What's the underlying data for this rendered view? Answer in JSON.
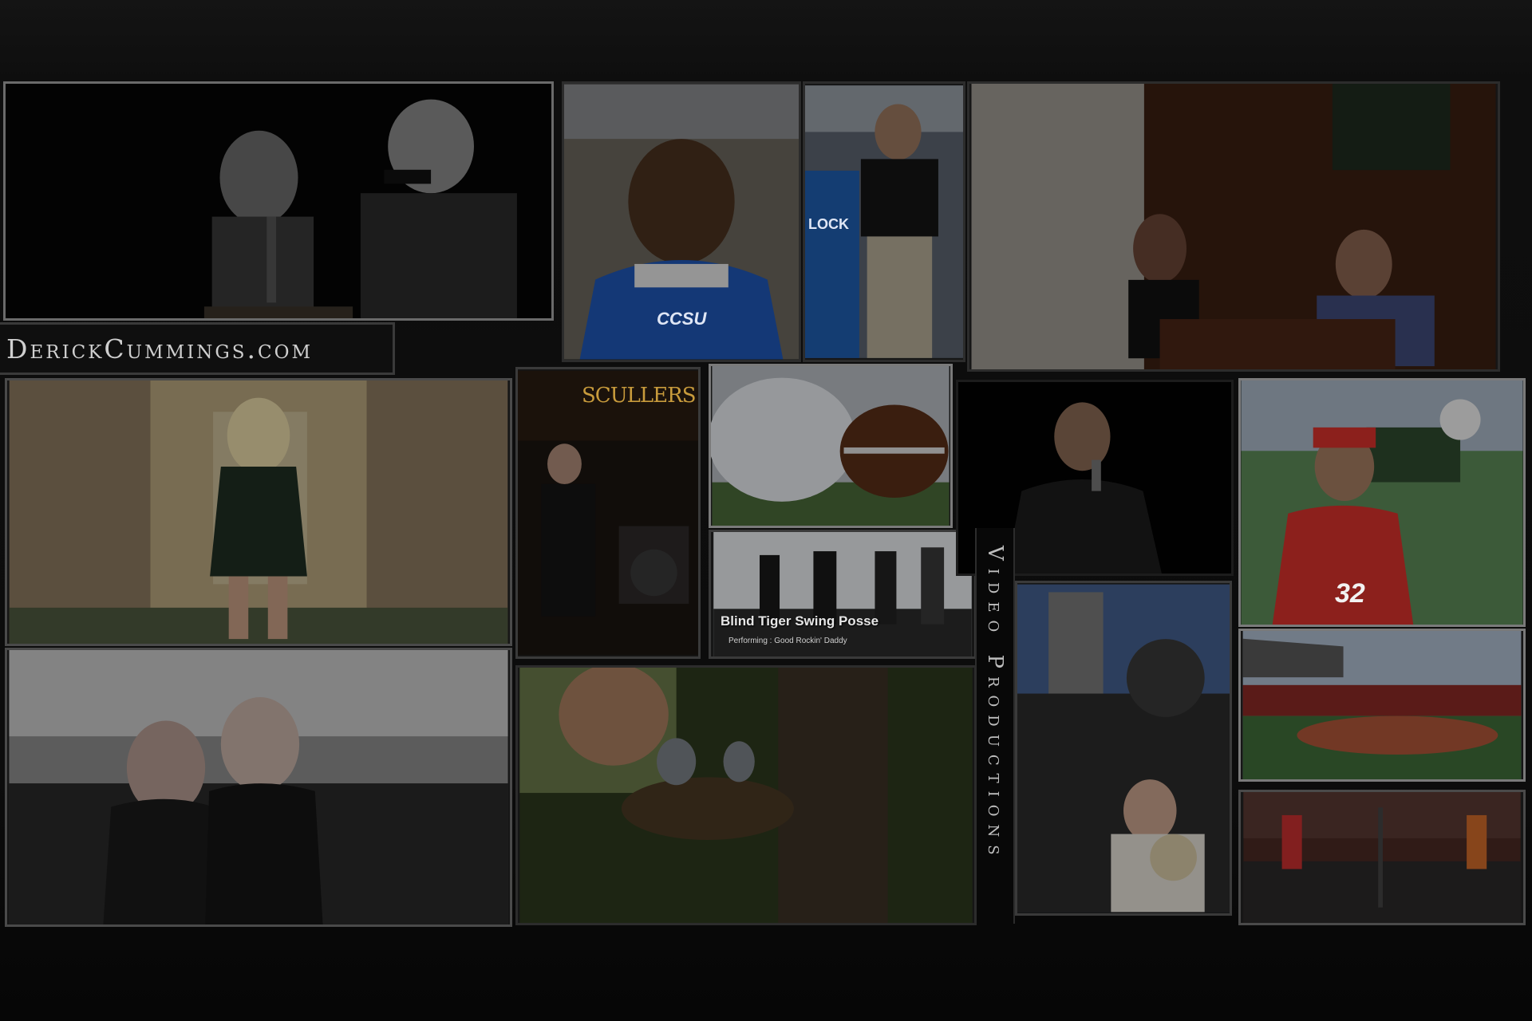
{
  "site": {
    "logo_text": "DerickCummings.com",
    "tagline": "Video Productions"
  },
  "tiles": {
    "speech": {
      "alt": "Two boys at a podium"
    },
    "football_player": {
      "alt": "Football player in blue jersey",
      "jersey_text": "CCSU"
    },
    "coach": {
      "alt": "Man standing by stadium",
      "jersey_text": "LOCK"
    },
    "restaurant": {
      "alt": "Couple at restaurant table"
    },
    "hallway_woman": {
      "alt": "Woman in hotel hallway"
    },
    "scullers": {
      "alt": "Saxophone player on stage",
      "sign_text": "SCULLERS"
    },
    "helmet_ball": {
      "alt": "Football helmet and ball"
    },
    "band": {
      "alt": "Band performing",
      "title": "Blind Tiger Swing Posse",
      "subtitle": "Performing : Good Rockin' Daddy"
    },
    "singer": {
      "alt": "Singer at microphone"
    },
    "baseball_player": {
      "alt": "Baseball player holding ball",
      "jersey_number": "32"
    },
    "couple_city": {
      "alt": "Couple portrait over city"
    },
    "boy_tree": {
      "alt": "Boy beside tree with nest"
    },
    "train_banjo": {
      "alt": "Man with banjo by steam locomotive"
    },
    "baseball_field": {
      "alt": "Camera crew at baseball field"
    },
    "badminton": {
      "alt": "Badminton players in gym"
    }
  }
}
